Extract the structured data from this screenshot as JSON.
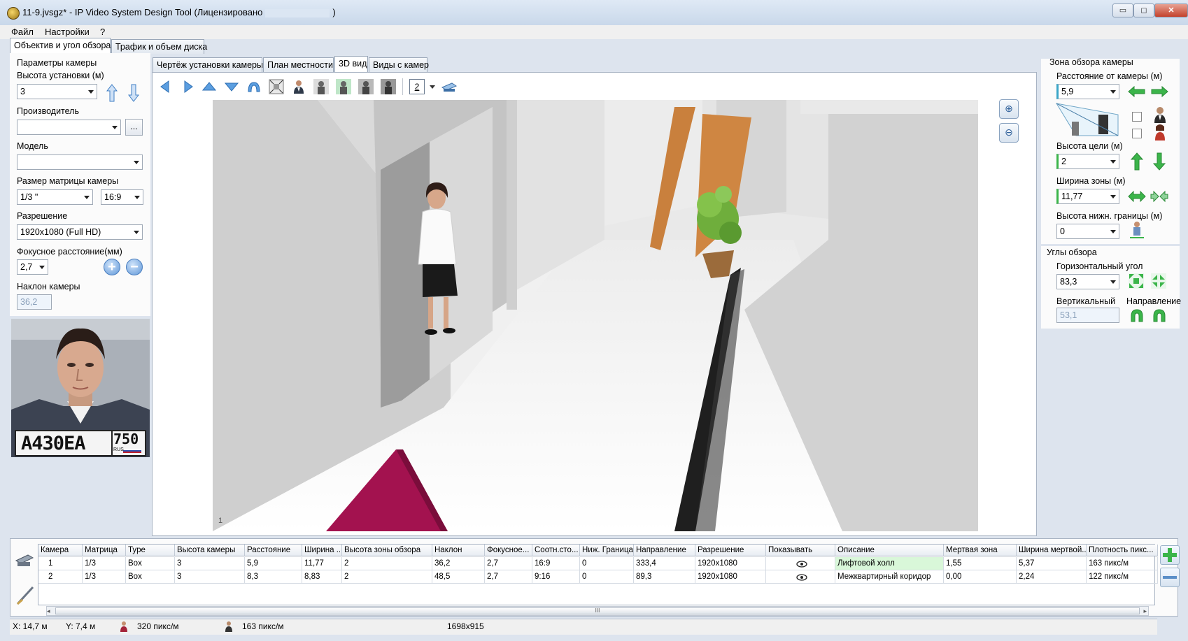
{
  "window": {
    "title": "11-9.jvsgz* - IP Video System Design Tool (Лицензировано",
    "title_end": ")",
    "min_label": "▭",
    "max_label": "◻",
    "close_label": "✕"
  },
  "menu": [
    "Файл",
    "Настройки",
    "?"
  ],
  "main_tabs": [
    "Объектив и угол обзора",
    "Трафик и объем диска"
  ],
  "left": {
    "group_title": "Параметры камеры",
    "height_label": "Высота установки (м)",
    "height_value": "3",
    "vendor_label": "Производитель",
    "vendor_value": "",
    "vendor_browse": "...",
    "model_label": "Модель",
    "model_value": "",
    "sensor_label": "Размер матрицы камеры",
    "sensor_value": "1/3 \"",
    "aspect_value": "16:9",
    "resolution_label": "Разрешение",
    "resolution_value": "1920x1080 (Full HD)",
    "focal_label": "Фокусное расстояние(мм)",
    "focal_value": "2,7",
    "tilt_label": "Наклон камеры",
    "tilt_value": "36,2",
    "plate_text": "А430ЕА",
    "plate_region": "750",
    "plate_country": "RUS"
  },
  "view_tabs": [
    "Чертёж установки камеры",
    "План местности",
    "3D вид",
    "Виды с камер"
  ],
  "view_toolbar": {
    "camera_number": "2"
  },
  "view3d": {
    "corner_label": "1"
  },
  "right": {
    "zone_title": "Зона обзора камеры",
    "distance_label": "Расстояние от камеры (м)",
    "distance_value": "5,9",
    "target_height_label": "Высота цели (м)",
    "target_height_value": "2",
    "zone_width_label": "Ширина зоны (м)",
    "zone_width_value": "11,77",
    "lower_bound_label": "Высота нижн. границы (м)",
    "lower_bound_value": "0",
    "angles_title": "Углы обзора",
    "horizontal_label": "Горизонтальный угол",
    "horizontal_value": "83,3",
    "vertical_label": "Вертикальный",
    "vertical_value": "53,1",
    "direction_label": "Направление"
  },
  "table": {
    "headers": [
      "Камера",
      "Матрица",
      "Type",
      "Высота камеры",
      "Расстояние",
      "Ширина ...",
      "Высота зоны обзора",
      "Наклон",
      "Фокусное...",
      "Соотн.сто...",
      "Ниж. Граница",
      "Направление",
      "Разрешение",
      "Показывать",
      "Описание",
      "Мертвая зона",
      "Ширина мертвой...",
      "Плотность пикс..."
    ],
    "rows": [
      [
        "1",
        "1/3",
        "Box",
        "3",
        "5,9",
        "11,77",
        "2",
        "36,2",
        "2,7",
        "16:9",
        "0",
        "333,4",
        "1920x1080",
        "",
        "Лифтовой холл",
        "1,55",
        "5,37",
        "163 пикс/м"
      ],
      [
        "2",
        "1/3",
        "Box",
        "3",
        "8,3",
        "8,83",
        "2",
        "48,5",
        "2,7",
        "9:16",
        "0",
        "89,3",
        "1920x1080",
        "",
        "Межквартирный коридор",
        "0,00",
        "2,24",
        "122 пикс/м"
      ]
    ],
    "scroll_grip": "III"
  },
  "status": {
    "x": "X: 14,7 м",
    "y": "Y: 7,4 м",
    "density_female": "320 пикс/м",
    "density_male": "163 пикс/м",
    "size": "1698x915"
  },
  "colors": {
    "accent_blue": "#4a8bd2",
    "green_arrow": "#3bb54a",
    "highlight_row": "#d9f7d9",
    "carpet": "#a3124f",
    "door": "#c37a3c"
  }
}
